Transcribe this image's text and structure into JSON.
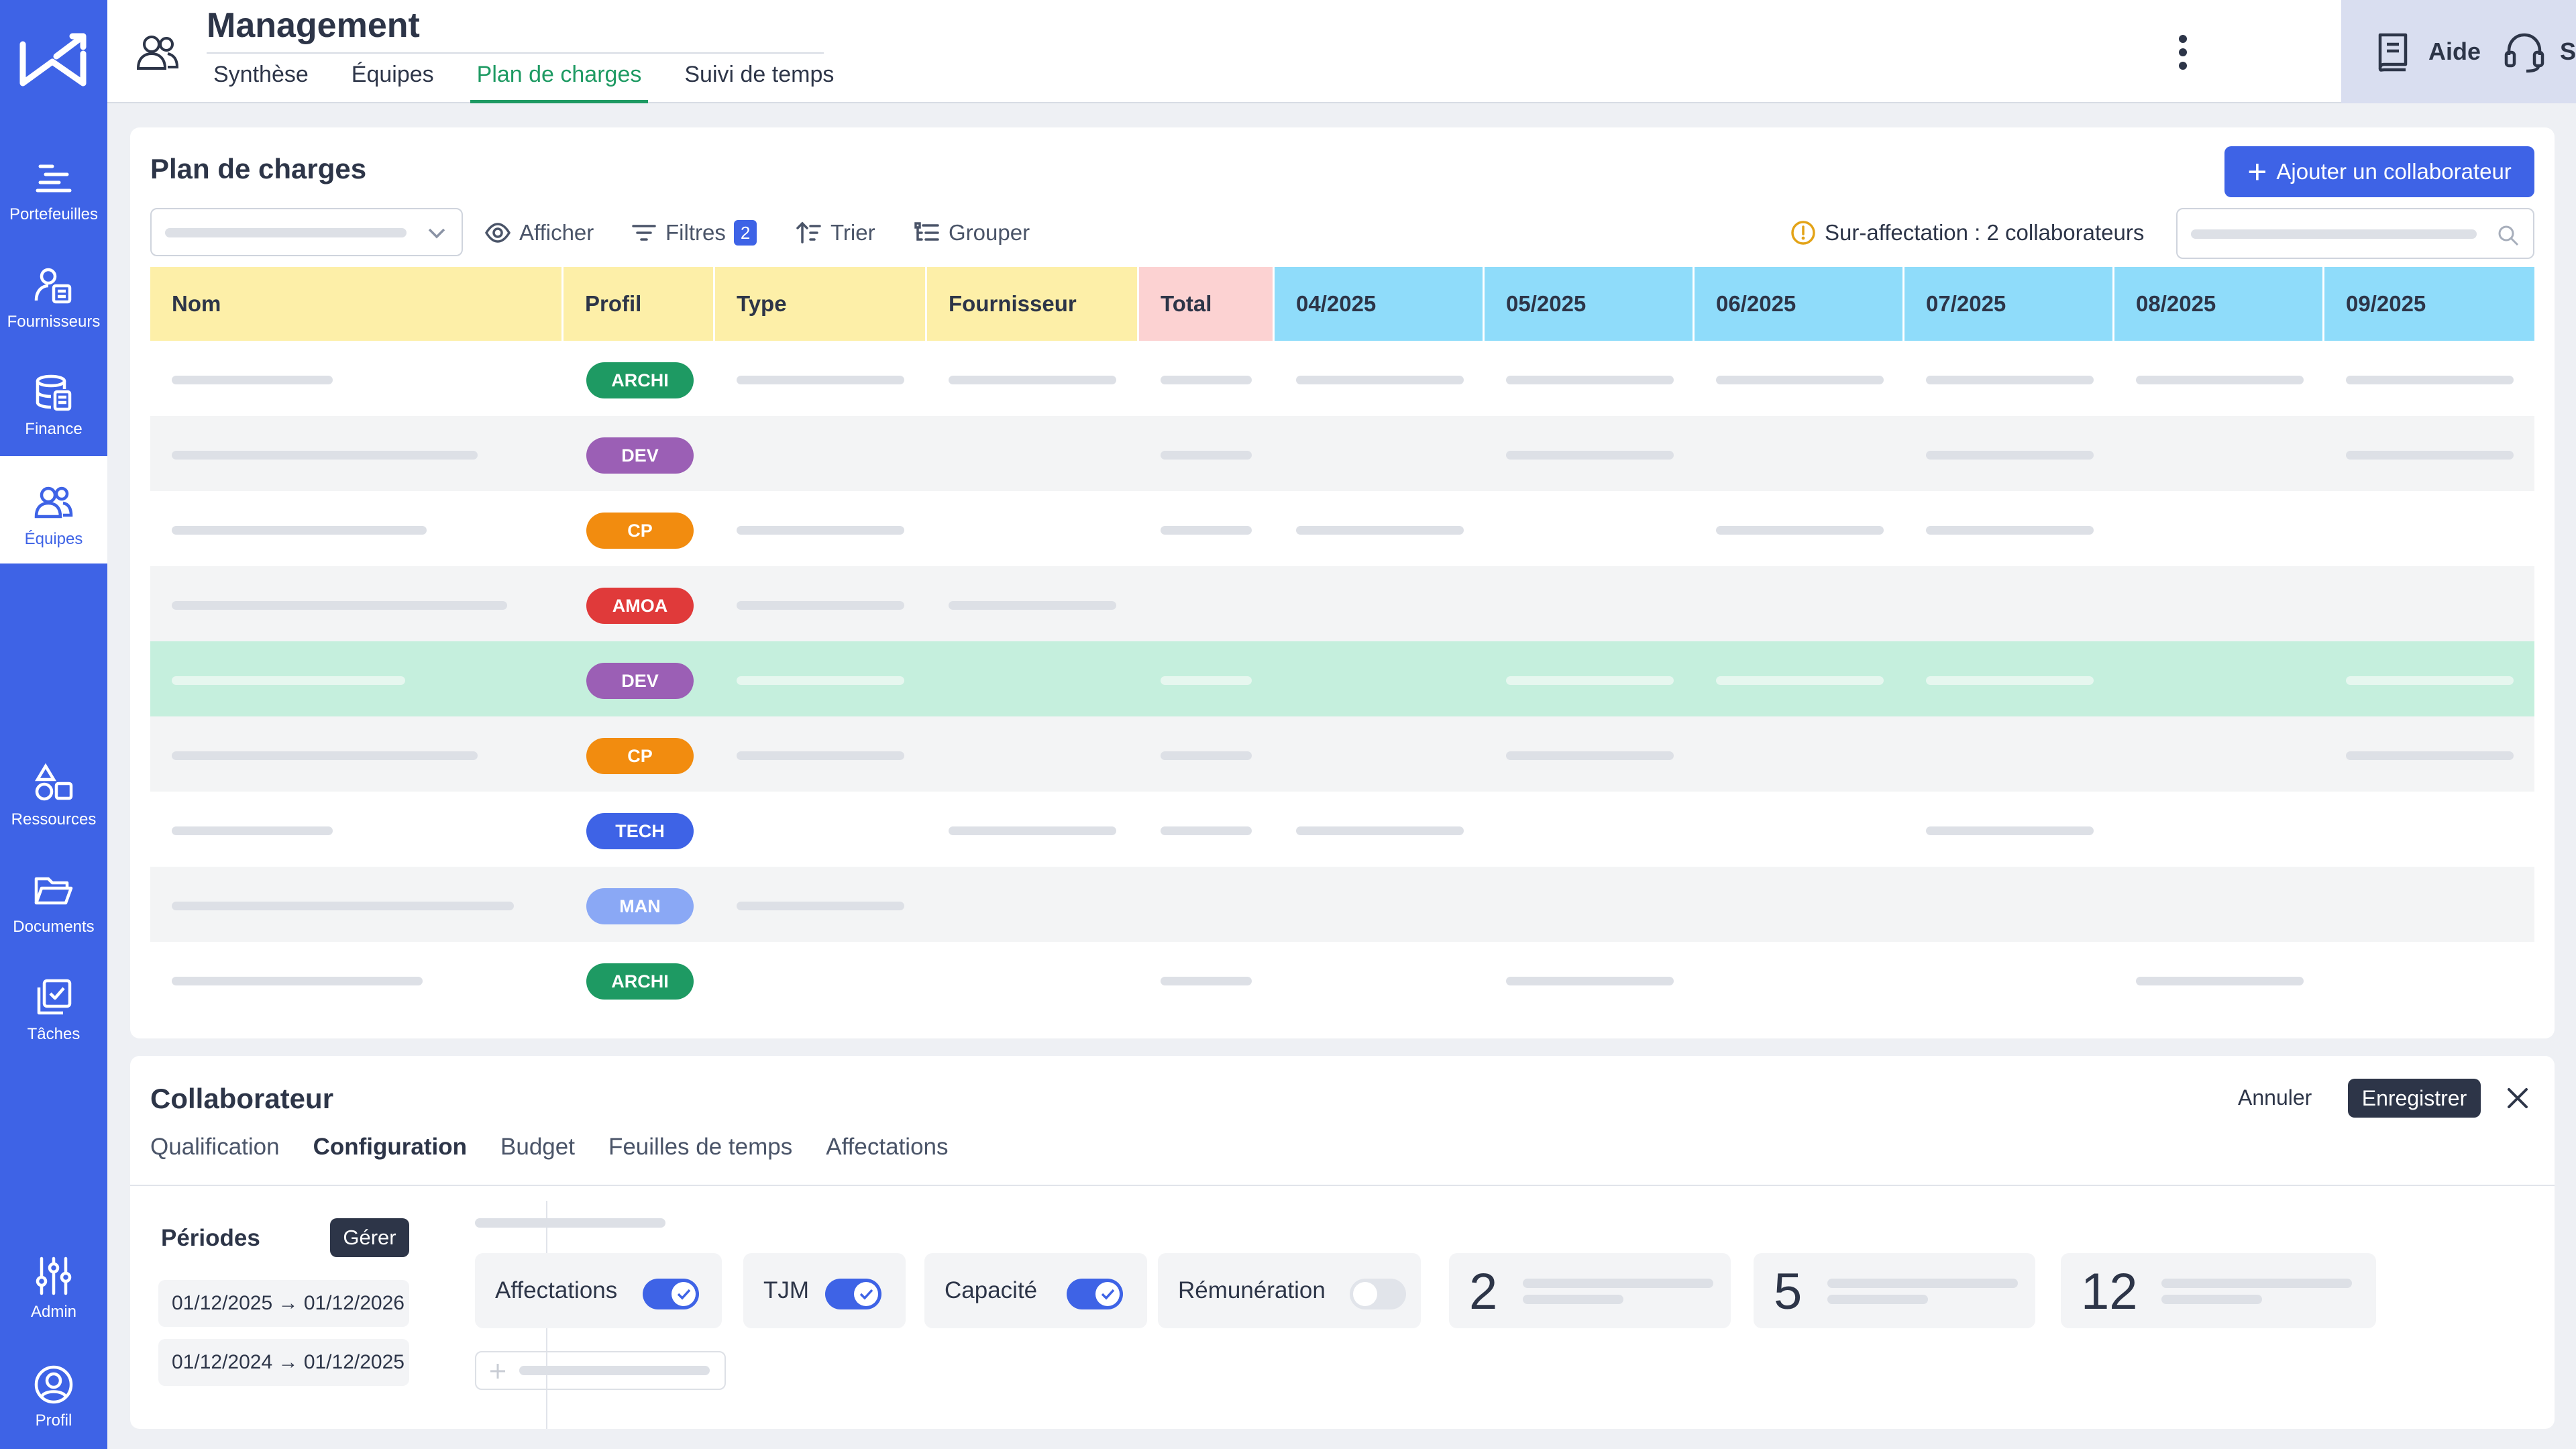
{
  "app": {
    "title": "Management",
    "tabs": [
      {
        "label": "Synthèse",
        "active": false
      },
      {
        "label": "Équipes",
        "active": false
      },
      {
        "label": "Plan de charges",
        "active": true
      },
      {
        "label": "Suivi de temps",
        "active": false
      }
    ],
    "help_label": "Aide",
    "support_label": "Support",
    "brand_color": "#3e63e6",
    "accent_green": "#1e9a63"
  },
  "sidebar": {
    "items": [
      {
        "label": "Portefeuilles",
        "icon": "portfolio-icon"
      },
      {
        "label": "Fournisseurs",
        "icon": "supplier-icon"
      },
      {
        "label": "Finance",
        "icon": "finance-icon"
      },
      {
        "label": "Équipes",
        "icon": "teams-icon",
        "active": true
      },
      {
        "label": "Ressources",
        "icon": "resources-icon"
      },
      {
        "label": "Documents",
        "icon": "folder-icon"
      },
      {
        "label": "Tâches",
        "icon": "tasks-icon"
      },
      {
        "label": "Admin",
        "icon": "sliders-icon"
      },
      {
        "label": "Profil",
        "icon": "user-circle-icon"
      }
    ]
  },
  "plan": {
    "title": "Plan de charges",
    "add_button": "Ajouter un collaborateur",
    "toolbar": {
      "afficher": "Afficher",
      "filtres": "Filtres",
      "filtres_count": "2",
      "trier": "Trier",
      "grouper": "Grouper"
    },
    "warning": "Sur-affectation : 2 collaborateurs",
    "columns": [
      "Nom",
      "Profil",
      "Type",
      "Fournisseur",
      "Total",
      "04/2025",
      "05/2025",
      "06/2025",
      "07/2025",
      "08/2025",
      "09/2025"
    ],
    "rows": [
      {
        "profil": "ARCHI",
        "color": "#1e9a63"
      },
      {
        "profil": "DEV",
        "color": "#9b5fb5"
      },
      {
        "profil": "CP",
        "color": "#f28c0f"
      },
      {
        "profil": "AMOA",
        "color": "#e03a3a"
      },
      {
        "profil": "DEV",
        "color": "#9b5fb5"
      },
      {
        "profil": "CP",
        "color": "#f28c0f"
      },
      {
        "profil": "TECH",
        "color": "#3e63e6"
      },
      {
        "profil": "MAN",
        "color": "#8aa8f5"
      },
      {
        "profil": "ARCHI",
        "color": "#1e9a63"
      }
    ]
  },
  "collaborateur": {
    "title": "Collaborateur",
    "annuler": "Annuler",
    "enregistrer": "Enregistrer",
    "tabs": [
      {
        "label": "Qualification",
        "active": false
      },
      {
        "label": "Configuration",
        "active": true
      },
      {
        "label": "Budget",
        "active": false
      },
      {
        "label": "Feuilles de temps",
        "active": false
      },
      {
        "label": "Affectations",
        "active": false
      }
    ],
    "periods_title": "Périodes",
    "gerer": "Gérer",
    "periods": [
      "01/12/2025 → 01/12/2026",
      "01/12/2024 → 01/12/2025"
    ],
    "toggles": [
      {
        "label": "Affectations",
        "on": true
      },
      {
        "label": "TJM",
        "on": true
      },
      {
        "label": "Capacité",
        "on": true
      },
      {
        "label": "Rémunération",
        "on": false
      }
    ],
    "stats": [
      "2",
      "5",
      "12"
    ]
  }
}
